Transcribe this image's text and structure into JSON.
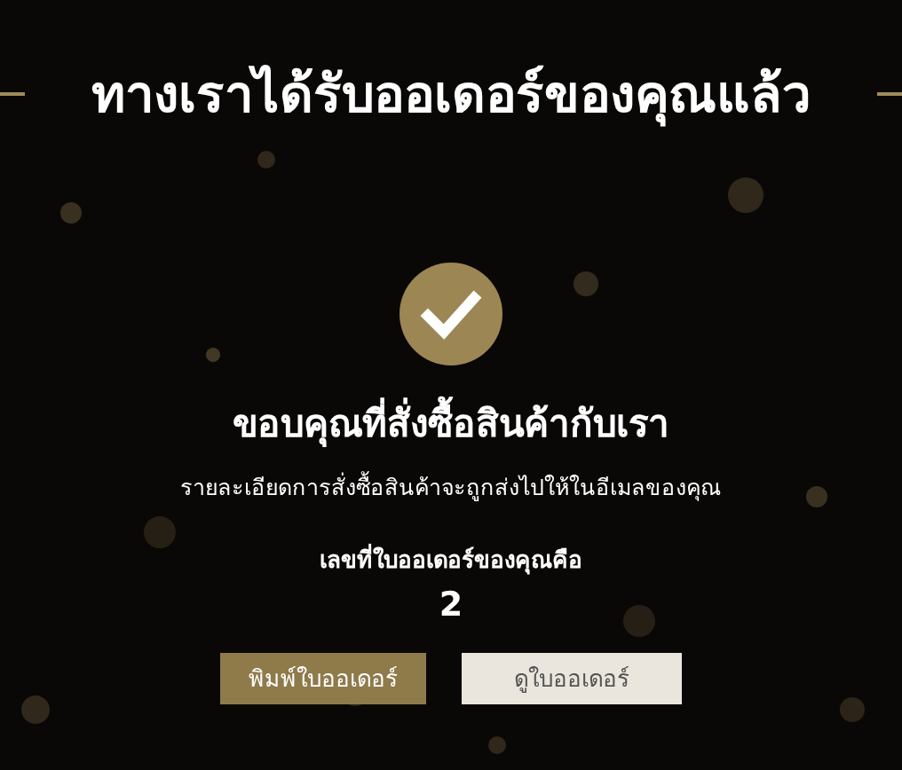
{
  "title": "ทางเราได้รับออเดอร์ของคุณแล้ว",
  "heading": "ขอบคุณที่สั่งซื้อสินค้ากับเรา",
  "message": "รายละเอียดการสั่งซื้อสินค้าจะถูกส่งไปให้ในอีเมลของคุณ",
  "order_label": "เลขที่ใบออเดอร์ของคุณคือ",
  "order_number": "2",
  "buttons": [
    {
      "label": "พิมพ์ใบออเดอร์",
      "kind": "primary"
    },
    {
      "label": "ดูใบออเดอร์",
      "kind": "secondary"
    }
  ]
}
